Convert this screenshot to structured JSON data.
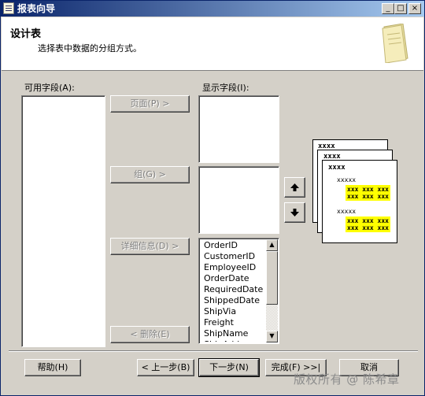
{
  "window": {
    "title": "报表向导",
    "caption_buttons": {
      "minimize": "_",
      "maximize": "□",
      "close": "×"
    }
  },
  "header": {
    "title": "设计表",
    "subtitle": "选择表中数据的分组方式。",
    "icon": "document-icon"
  },
  "available_fields": {
    "label": "可用字段(A):",
    "items": []
  },
  "displayed_fields": {
    "label": "显示字段(I):"
  },
  "move_buttons": {
    "page": "页面(P) >",
    "group": "组(G) >",
    "details": "详细信息(D) >",
    "remove": "< 删除(E)"
  },
  "detail_fields": [
    "OrderID",
    "CustomerID",
    "EmployeeID",
    "OrderDate",
    "RequiredDate",
    "ShippedDate",
    "ShipVia",
    "Freight",
    "ShipName",
    "ShipAdd"
  ],
  "reorder": {
    "up_icon": "arrow-up-icon",
    "down_icon": "arrow-down-icon"
  },
  "preview": {
    "page_labels": [
      "xxxx",
      "xxxx",
      "xxxx"
    ],
    "group_label": "xxxxx",
    "detail_block": "xxx xxx xxx\nxxx xxx xxx",
    "highlight_color": "#ffff00"
  },
  "footer": {
    "help": "帮助(H)",
    "back": "< 上一步(B)",
    "next": "下一步(N)",
    "finish": "完成(F) >>|",
    "cancel": "取消"
  },
  "watermark": "版权所有 @ 陈希章"
}
